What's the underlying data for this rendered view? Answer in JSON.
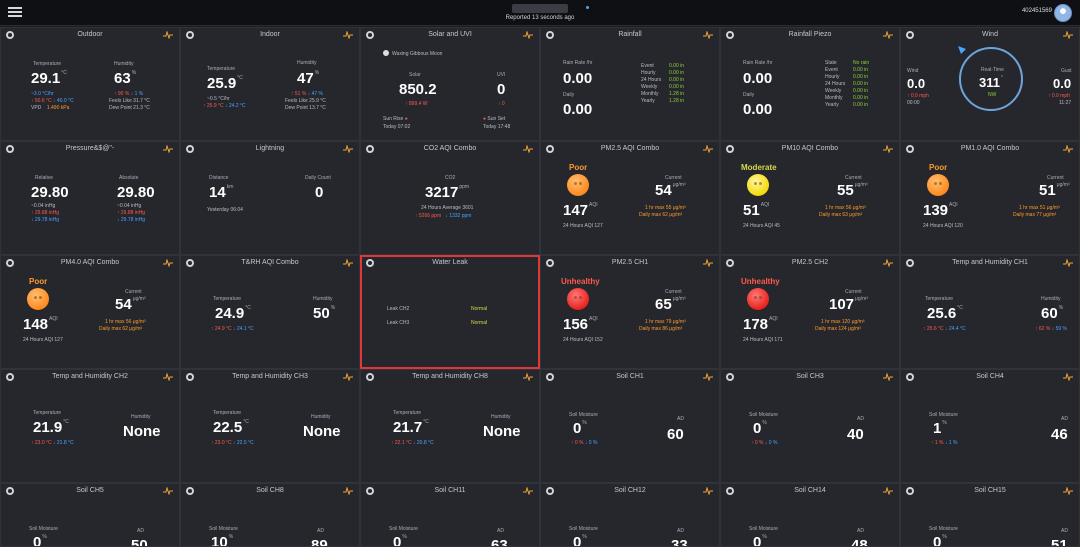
{
  "header": {
    "reported": "Reported 13 seconds ago",
    "user_id": "402451569"
  },
  "cards": {
    "outdoor": {
      "title": "Outdoor",
      "temp_label": "Temperature",
      "temp": "29.1",
      "temp_unit": "°C",
      "dew_line": "~3.0 °C/hr",
      "high": "↑ 50.6 °C",
      "low": "↓ 40.0 °C",
      "vpd_label": "VPD",
      "vpd": "1.490 kPa",
      "hum_label": "Humidity",
      "hum": "63",
      "hum_unit": "%",
      "hum_high": "↑ 90 %",
      "hum_low": "↓ 1 %",
      "feels": "Feels Like  31.7 °C",
      "dew": "Dew Point  21.3 °C"
    },
    "indoor": {
      "title": "Indoor",
      "temp_label": "Temperature",
      "temp": "25.9",
      "temp_unit": "°C",
      "rate": "~0.5 °C/hr",
      "high": "↑ 25.9 °C",
      "low": "↓ 24.2 °C",
      "hum_label": "Humidity",
      "hum": "47",
      "hum_unit": "%",
      "hum_high": "↑ 51 %",
      "hum_low": "↓ 47 %",
      "feels": "Feels Like  25.9 °C",
      "dew": "Dew Point  13.7 °C"
    },
    "solar": {
      "title": "Solar and UVI",
      "moon": "Waxing Gibbous Moon",
      "solar_label": "Solar",
      "solar": "850.2",
      "solar_max": "↑ 899.4 W",
      "uvi_label": "UVI",
      "uvi": "0",
      "uvi_max": "↑ 0",
      "sunrise_label": "Sun Rise",
      "sunrise": "Today 07:02",
      "sunset_label": "Sun Set",
      "sunset": "Today 17:48"
    },
    "rainfall": {
      "title": "Rainfall",
      "rate_label": "Rain Rate /hr",
      "rate": "0.00",
      "daily_label": "Daily",
      "daily": "0.00",
      "rows": [
        [
          "Event",
          "0.00 in"
        ],
        [
          "Hourly",
          "0.00 in"
        ],
        [
          "24 Hours",
          "0.00 in"
        ],
        [
          "Weekly",
          "0.00 in"
        ],
        [
          "Monthly",
          "1.28 in"
        ],
        [
          "Yearly",
          "1.28 in"
        ]
      ]
    },
    "piezo": {
      "title": "Rainfall Piezo",
      "rate_label": "Rain Rate /hr",
      "rate": "0.00",
      "daily_label": "Daily",
      "daily": "0.00",
      "rows": [
        [
          "State",
          "No rain"
        ],
        [
          "Event",
          "0.00 in"
        ],
        [
          "Hourly",
          "0.00 in"
        ],
        [
          "24 Hours",
          "0.00 in"
        ],
        [
          "Weekly",
          "0.00 in"
        ],
        [
          "Monthly",
          "0.00 in"
        ],
        [
          "Yearly",
          "0.00 in"
        ]
      ]
    },
    "wind": {
      "title": "Wind",
      "wind_label": "Wind",
      "wind": "0.0",
      "wind_max": "↑ 0.0 mph",
      "wind_time": "00:00",
      "center_label": "Real-Time",
      "dir": "311",
      "dir_unit": "°",
      "dir_text": "NW",
      "gust_label": "Gust",
      "gust": "0.0",
      "gust_max": "↑ 0.0 mph",
      "gust_time": "11:27"
    },
    "pressure": {
      "title": "Pressure&$@\"-",
      "rel_label": "Relative",
      "rel": "29.80",
      "rel_rate": "~0.04 inHg",
      "rel_high": "↑ 29.88 inHg",
      "rel_low": "↓ 29.78 inHg",
      "abs_label": "Absolute",
      "abs": "29.80",
      "abs_rate": "~0.04 inHg",
      "abs_high": "↑ 29.88 inHg",
      "abs_low": "↓ 29.78 inHg"
    },
    "lightning": {
      "title": "Lightning",
      "dist_label": "Distance",
      "dist": "14",
      "dist_unit": "km",
      "when": "Yesterday 06:04",
      "count_label": "Daily Count",
      "count": "0"
    },
    "co2": {
      "title": "CO2 AQI Combo",
      "label": "CO2",
      "value": "3217",
      "unit": "ppm",
      "avg": "24 Hours Average  3601",
      "high": "↑ 5266 ppm",
      "low": "↓ 1332 ppm"
    },
    "pm25": {
      "title": "PM2.5 AQI Combo",
      "status": "Poor",
      "cur_label": "Current",
      "cur": "54",
      "cur_unit": "μg/m³",
      "aqi": "147",
      "aqi_unit": "AQI",
      "hr_max": "1 hr max   55 μg/m³",
      "daily_max": "Daily max  62 μg/m³",
      "avg": "24 Hours AQI  127"
    },
    "pm10": {
      "title": "PM10 AQI Combo",
      "status": "Moderate",
      "cur_label": "Current",
      "cur": "55",
      "cur_unit": "μg/m³",
      "aqi": "51",
      "aqi_unit": "AQI",
      "hr_max": "1 hr max   56 μg/m³",
      "daily_max": "Daily max  63 μg/m³",
      "avg": "24 Hours AQI  45"
    },
    "pm1": {
      "title": "PM1.0 AQI Combo",
      "status": "Poor",
      "cur_label": "Current",
      "cur": "51",
      "cur_unit": "μg/m³",
      "aqi": "139",
      "aqi_unit": "AQI",
      "hr_max": "1 hr max   51 μg/m³",
      "daily_max": "Daily max  77 μg/m³",
      "avg": "24 Hours AQI  120"
    },
    "pm4": {
      "title": "PM4.0 AQI Combo",
      "status": "Poor",
      "cur_label": "Current",
      "cur": "54",
      "cur_unit": "μg/m³",
      "aqi": "148",
      "aqi_unit": "AQI",
      "hr_max": "1 hr max   56 μg/m³",
      "daily_max": "Daily max  62 μg/m³",
      "avg": "24 Hours AQI  127"
    },
    "trh": {
      "title": "T&RH AQI Combo",
      "temp_label": "Temperature",
      "temp": "24.9",
      "temp_unit": "°C",
      "high": "↑ 24.9 °C",
      "low": "↓ 24.1 °C",
      "hum_label": "Humidity",
      "hum": "50",
      "hum_unit": "%"
    },
    "leak": {
      "title": "Water Leak",
      "ch2": "Leak CH2",
      "ch2_val": "Normal",
      "ch3": "Leak CH3",
      "ch3_val": "Normal"
    },
    "pm25ch1": {
      "title": "PM2.5 CH1",
      "status": "Unhealthy",
      "cur_label": "Current",
      "cur": "65",
      "cur_unit": "μg/m³",
      "aqi": "156",
      "aqi_unit": "AQI",
      "hr_max": "1 hr max   79 μg/m³",
      "daily_max": "Daily max  86 μg/m³",
      "avg": "24 Hours AQI  152"
    },
    "pm25ch2": {
      "title": "PM2.5 CH2",
      "status": "Unhealthy",
      "cur_label": "Current",
      "cur": "107",
      "cur_unit": "μg/m³",
      "aqi": "178",
      "aqi_unit": "AQI",
      "hr_max": "1 hr max   120 μg/m³",
      "daily_max": "Daily max  124 μg/m³",
      "avg": "24 Hours AQI  171"
    },
    "thch1": {
      "title": "Temp and Humidity CH1",
      "temp_label": "Temperature",
      "temp": "25.6",
      "temp_unit": "°C",
      "high": "↑ 25.6 °C",
      "low": "↓ 24.4 °C",
      "hum_label": "Humidity",
      "hum": "60",
      "hum_unit": "%",
      "hum_high": "↑ 62 %",
      "hum_low": "↓ 59 %"
    },
    "thch2": {
      "title": "Temp and Humidity CH2",
      "temp_label": "Temperature",
      "temp": "21.9",
      "temp_unit": "°C",
      "high": "↑ 23.0 °C",
      "low": "↓ 21.8 °C",
      "hum_label": "Humidity",
      "hum": "None"
    },
    "thch3": {
      "title": "Temp and Humidity CH3",
      "temp_label": "Temperature",
      "temp": "22.5",
      "temp_unit": "°C",
      "high": "↑ 23.0 °C",
      "low": "↓ 22.5 °C",
      "hum_label": "Humidity",
      "hum": "None"
    },
    "thch8": {
      "title": "Temp and Humidity CH8",
      "temp_label": "Temperature",
      "temp": "21.7",
      "temp_unit": "°C",
      "high": "↑ 22.1 °C",
      "low": "↓ 20.8 °C",
      "hum_label": "Humidity",
      "hum": "None"
    },
    "soil1": {
      "title": "Soil CH1",
      "m_label": "Soil Moisture",
      "m": "0",
      "m_unit": "%",
      "m_hi": "↑ 0 %",
      "m_lo": "↓ 0 %",
      "ad_label": "AD",
      "ad": "60"
    },
    "soil3": {
      "title": "Soil CH3",
      "m_label": "Soil Moisture",
      "m": "0",
      "m_unit": "%",
      "m_hi": "↑ 0 %",
      "m_lo": "↓ 0 %",
      "ad_label": "AD",
      "ad": "40"
    },
    "soil4": {
      "title": "Soil CH4",
      "m_label": "Soil Moisture",
      "m": "1",
      "m_unit": "%",
      "m_hi": "↑ 1 %",
      "m_lo": "↓ 1 %",
      "ad_label": "AD",
      "ad": "46"
    },
    "soil5": {
      "title": "Soil CH5",
      "m_label": "Soil Moisture",
      "m": "0",
      "m_unit": "%",
      "ad_label": "AD",
      "ad": "50"
    },
    "soil8": {
      "title": "Soil CH8",
      "m_label": "Soil Moisture",
      "m": "10",
      "m_unit": "%",
      "ad_label": "AD",
      "ad": "89"
    },
    "soil11": {
      "title": "Soil CH11",
      "m_label": "Soil Moisture",
      "m": "0",
      "m_unit": "%",
      "ad_label": "AD",
      "ad": "63"
    },
    "soil12": {
      "title": "Soil CH12",
      "m_label": "Soil Moisture",
      "m": "0",
      "m_unit": "%",
      "ad_label": "AD",
      "ad": "33"
    },
    "soil14": {
      "title": "Soil CH14",
      "m_label": "Soil Moisture",
      "m": "0",
      "m_unit": "%",
      "ad_label": "AD",
      "ad": "48"
    },
    "soil15": {
      "title": "Soil CH15",
      "m_label": "Soil Moisture",
      "m": "0",
      "m_unit": "%",
      "ad_label": "AD",
      "ad": "51"
    }
  }
}
